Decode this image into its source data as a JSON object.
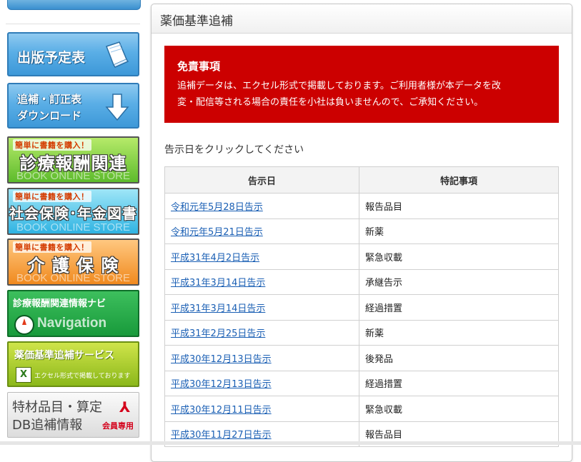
{
  "sidebar": {
    "publication_schedule": "出版予定表",
    "supplement_download_line1": "追補・訂正表",
    "supplement_download_line2": "ダウンロード",
    "store_banners": [
      {
        "small": "簡単に書籍を購入！",
        "big": "診療報酬関連",
        "tag": "BOOK ONLINE STORE"
      },
      {
        "small": "簡単に書籍を購入！",
        "big": "社会保険･年金図書",
        "tag": "BOOK ONLINE STORE"
      },
      {
        "small": "簡単に書籍を購入！",
        "big": "介 護 保 険",
        "tag": "BOOK ONLINE STORE"
      }
    ],
    "navi_title": "診療報酬関連情報ナビ",
    "navi_word": "Navigation",
    "drug_service_title": "薬価基準追補サービス",
    "drug_service_sub": "エクセル形式で掲載しております",
    "special_line1": "特材品目・算定",
    "special_line2": "DB追補情報",
    "special_member": "会員専用",
    "colors": {
      "blue": "#3d98d8",
      "green": "#5dbb2c",
      "nav_green": "#189a3b",
      "lime": "#8bb81a"
    }
  },
  "main": {
    "title": "薬価基準追補",
    "notice": {
      "title": "免責事項",
      "line1": "追補データは、エクセル形式で掲載しております。ご利用者様が本データを改",
      "line2": "変・配信等される場合の責任を小社は負いませんので、ご承知ください。",
      "background": "#cc0000"
    },
    "instruction": "告示日をクリックしてください",
    "table": {
      "headers": [
        "告示日",
        "特記事項"
      ],
      "rows": [
        {
          "date": "令和元年5月28日告示",
          "note": "報告品目"
        },
        {
          "date": "令和元年5月21日告示",
          "note": "新薬"
        },
        {
          "date": "平成31年4月2日告示",
          "note": "緊急収載"
        },
        {
          "date": "平成31年3月14日告示",
          "note": "承継告示"
        },
        {
          "date": "平成31年3月14日告示",
          "note": "経過措置"
        },
        {
          "date": "平成31年2月25日告示",
          "note": "新薬"
        },
        {
          "date": "平成30年12月13日告示",
          "note": "後発品"
        },
        {
          "date": "平成30年12月13日告示",
          "note": "経過措置"
        },
        {
          "date": "平成30年12月11日告示",
          "note": "緊急収載"
        },
        {
          "date": "平成30年11月27日告示",
          "note": "報告品目"
        }
      ]
    }
  }
}
